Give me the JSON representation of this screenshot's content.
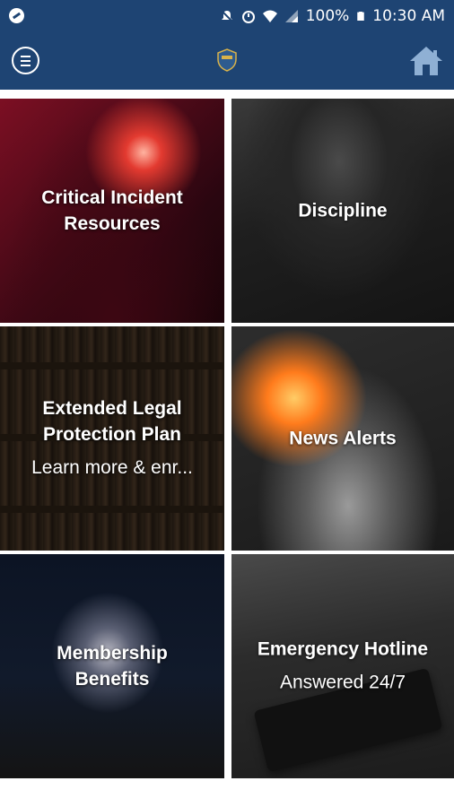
{
  "status_bar": {
    "battery_percent": "100%",
    "time": "10:30 AM",
    "icons": [
      "app-notification-icon",
      "mute-icon",
      "alarm-icon",
      "wifi-icon",
      "signal-icon",
      "battery-icon"
    ]
  },
  "app_bar": {
    "menu_icon": "menu-icon",
    "logo": "badge-logo",
    "home_icon": "home-icon",
    "color": "#1e4473"
  },
  "tiles": [
    {
      "title_line1": "Critical Incident",
      "title_line2": "Resources"
    },
    {
      "title": "Discipline"
    },
    {
      "title_line1": "Extended Legal",
      "title_line2": "Protection Plan",
      "subtitle": "Learn more & enr..."
    },
    {
      "title": "News Alerts"
    },
    {
      "title_line1": "Membership",
      "title_line2": "Benefits"
    },
    {
      "title": "Emergency Hotline",
      "subtitle": "Answered 24/7"
    }
  ]
}
